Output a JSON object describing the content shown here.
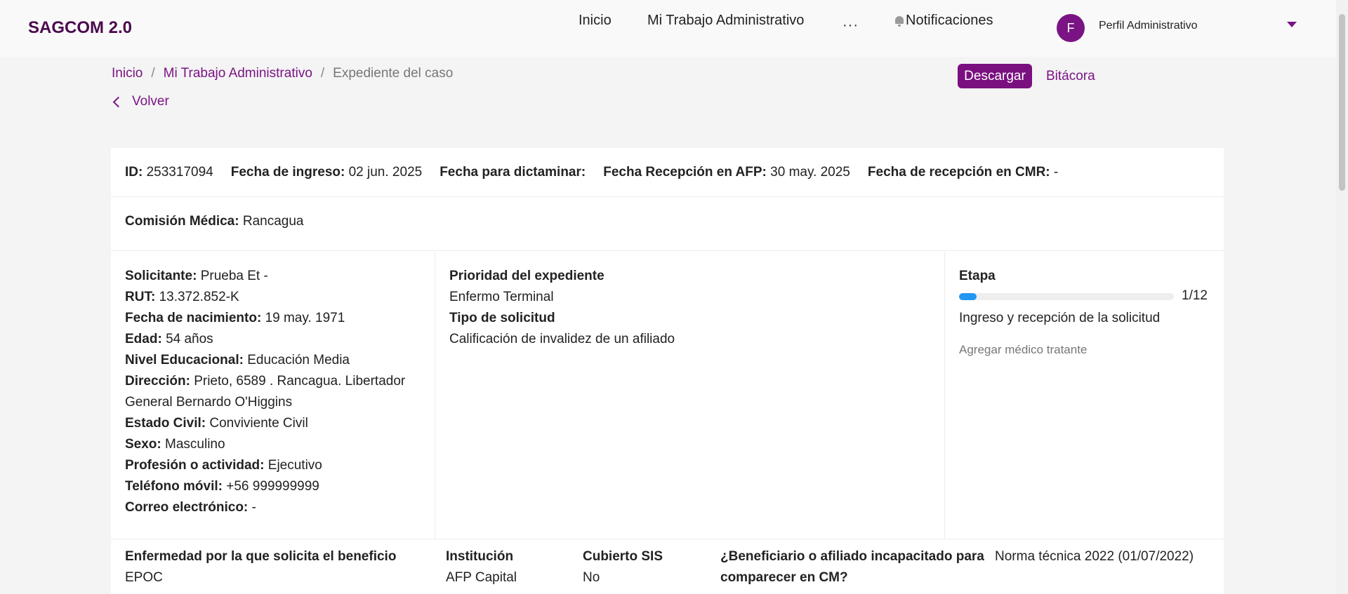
{
  "app": {
    "title": "SAGCOM 2.0"
  },
  "nav": {
    "items": [
      "Inicio",
      "Mi Trabajo Administrativo"
    ],
    "more": "···",
    "notifications": "Notificaciones"
  },
  "user": {
    "initial": "F",
    "profile": "Perfil Administrativo"
  },
  "breadcrumb": {
    "home": "Inicio",
    "section": "Mi Trabajo Administrativo",
    "current": "Expediente del caso",
    "sep": "/"
  },
  "back_label": "Volver",
  "summary": {
    "id_label": "ID:",
    "id": "253317094",
    "ingreso_label": "Fecha de ingreso:",
    "ingreso": "02 jun. 2025",
    "dictaminar_label": "Fecha para dictaminar:",
    "afp_label": "Fecha Recepción en AFP:",
    "afp": "30 may. 2025",
    "cmr_label": "Fecha de recepción en CMR:",
    "cmr": "-"
  },
  "commission": {
    "label": "Comisión Médica:",
    "value": "Rancagua"
  },
  "actions": {
    "download": "Descargar",
    "log": "Bitácora"
  },
  "applicant": {
    "solicitante_label": "Solicitante:",
    "solicitante": "Prueba Et -",
    "rut_label": "RUT:",
    "rut": "13.372.852-K",
    "nacimiento_label": "Fecha de nacimiento:",
    "nacimiento": "19 may. 1971",
    "edad_label": "Edad:",
    "edad": "54 años",
    "nivel_label": "Nivel Educacional:",
    "nivel": "Educación Media",
    "direccion_label": "Dirección:",
    "direccion": "Prieto, 6589 . Rancagua. Libertador General Bernardo O'Higgins",
    "estado_label": "Estado Civil:",
    "estado": "Conviviente Civil",
    "sexo_label": "Sexo:",
    "sexo": "Masculino",
    "profesion_label": "Profesión o actividad:",
    "profesion": "Ejecutivo",
    "telefono_label": "Teléfono móvil:",
    "telefono": "+56 999999999",
    "correo_label": "Correo electrónico:",
    "correo": "-"
  },
  "case": {
    "prioridad_label": "Prioridad del expediente",
    "prioridad": "Enfermo Terminal",
    "tipo_label": "Tipo de solicitud",
    "tipo": "Calificación de invalidez de un afiliado"
  },
  "stage": {
    "label": "Etapa",
    "progress_text": "1/12",
    "progress_fraction": 0.083,
    "name": "Ingreso y recepción de la solicitud",
    "add_doctor": "Agregar médico tratante"
  },
  "details": {
    "enfermedad_label": "Enfermedad por la que solicita el beneficio",
    "enfermedad": "EPOC",
    "institucion_label": "Institución",
    "institucion": "AFP Capital",
    "sis_label": "Cubierto SIS",
    "sis": "No",
    "incapacitado_label": "¿Beneficiario o afiliado incapacitado para comparecer en CM?",
    "norma": "Norma técnica 2022 (01/07/2022)"
  },
  "colors": {
    "brand": "#4a0a4e",
    "accent": "#7a1484",
    "progress": "#2196f3"
  }
}
